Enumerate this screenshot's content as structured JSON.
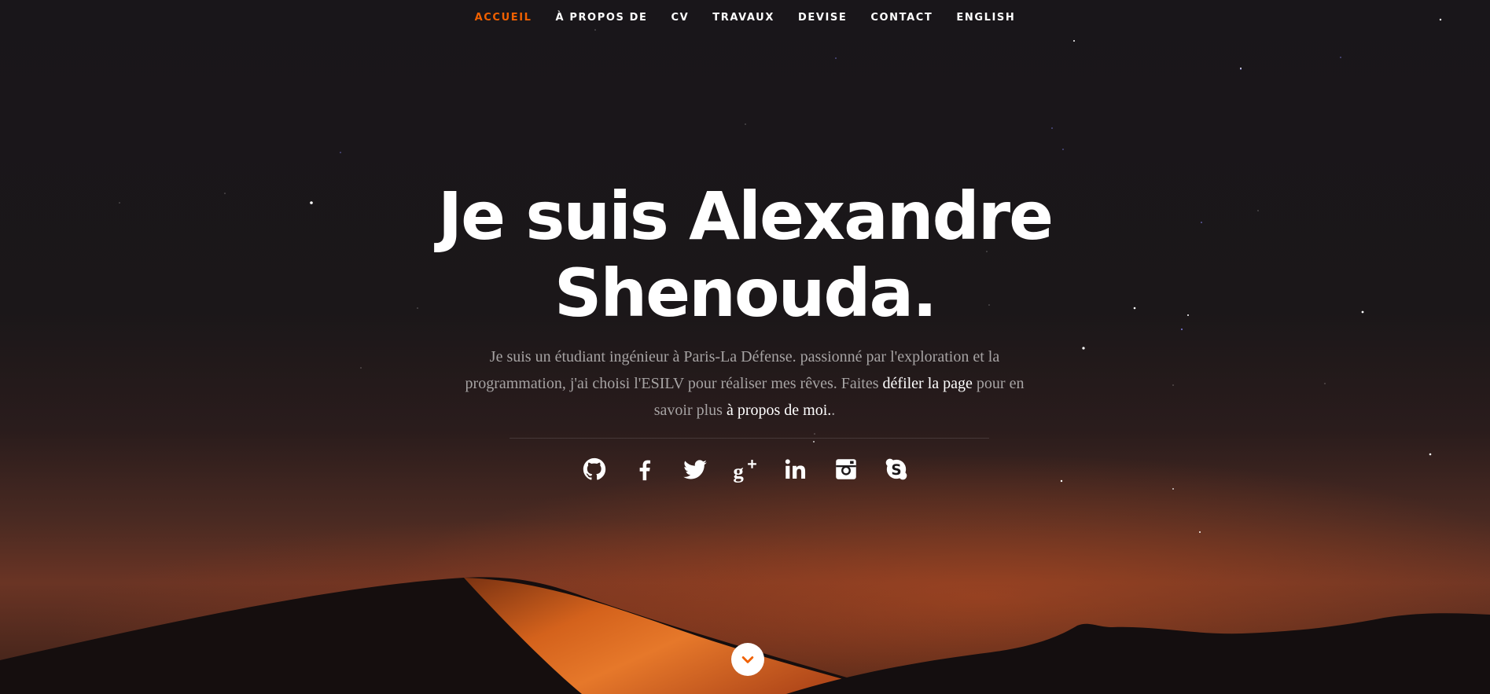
{
  "nav": {
    "items": [
      {
        "label": "ACCUEIL",
        "active": true
      },
      {
        "label": "À PROPOS DE",
        "active": false
      },
      {
        "label": "CV",
        "active": false
      },
      {
        "label": "TRAVAUX",
        "active": false
      },
      {
        "label": "DEVISE",
        "active": false
      },
      {
        "label": "CONTACT",
        "active": false
      },
      {
        "label": "ENGLISH",
        "active": false
      }
    ]
  },
  "hero": {
    "headline_line1": "Je suis Alexandre",
    "headline_line2": "Shenouda.",
    "intro_part1": "Je suis un étudiant ingénieur à Paris-La Défense. passionné par l'exploration et la programmation, j'ai choisi l'ESILV pour réaliser mes rêves.  Faites ",
    "scroll_link": "défiler la page",
    "intro_part2": " pour en savoir plus ",
    "about_link": "à propos de moi.",
    "intro_end": "."
  },
  "social": [
    {
      "icon": "github-icon"
    },
    {
      "icon": "facebook-icon"
    },
    {
      "icon": "twitter-icon"
    },
    {
      "icon": "google-plus-icon"
    },
    {
      "icon": "linkedin-icon"
    },
    {
      "icon": "instagram-icon"
    },
    {
      "icon": "skype-icon"
    }
  ],
  "scroll_button": {
    "icon": "chevron-down-icon"
  },
  "colors": {
    "accent": "#f06000",
    "background": "#1a1719",
    "text": "#ffffff",
    "muted_text": "#a6a3a3"
  }
}
